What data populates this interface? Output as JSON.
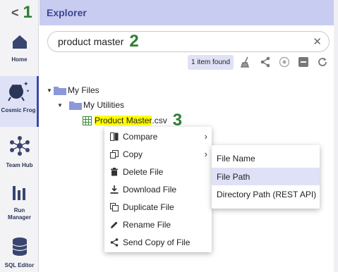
{
  "sidebar": {
    "collapse_number": "1",
    "items": [
      {
        "label": "Home",
        "icon": "house-icon"
      },
      {
        "label": "Cosmic Frog",
        "icon": "frog-icon"
      },
      {
        "label": "Team Hub",
        "icon": "network-icon"
      },
      {
        "label": "Run Manager",
        "icon": "bars-icon"
      },
      {
        "label": "SQL Editor",
        "icon": "database-icon"
      }
    ]
  },
  "explorer": {
    "title": "Explorer",
    "search": {
      "value": "product master",
      "step": "2"
    },
    "result_badge": "1 item found"
  },
  "tree": {
    "root": "My Files",
    "child": "My Utilities",
    "file_highlight": "Product Master",
    "file_ext": ".csv",
    "step": "3"
  },
  "context_menu": {
    "items": [
      {
        "label": "Compare",
        "icon": "compare-icon",
        "submenu": true
      },
      {
        "label": "Copy",
        "icon": "copy-icon",
        "submenu": true
      },
      {
        "label": "Delete File",
        "icon": "trash-icon"
      },
      {
        "label": "Download File",
        "icon": "download-icon"
      },
      {
        "label": "Duplicate File",
        "icon": "duplicate-icon"
      },
      {
        "label": "Rename File",
        "icon": "pencil-icon"
      },
      {
        "label": "Send Copy of File",
        "icon": "share-icon"
      }
    ]
  },
  "copy_submenu": {
    "items": [
      "File Name",
      "File Path",
      "Directory Path (REST API)"
    ],
    "selected": "File Path"
  },
  "colors": {
    "accent": "#3b4593",
    "header_bg": "#c8ccf0",
    "highlight": "#ffff00",
    "step_green": "#2e7d32"
  }
}
